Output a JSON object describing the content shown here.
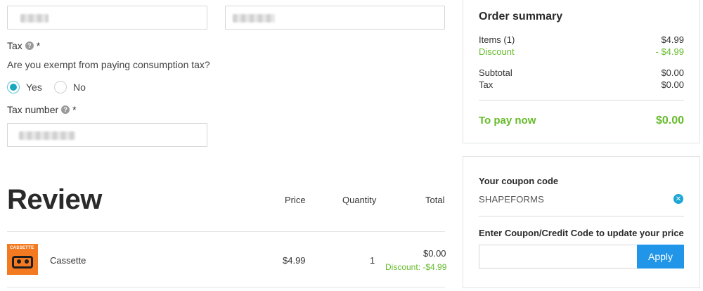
{
  "form": {
    "tax_label": "Tax",
    "tax_required": "*",
    "tax_question": "Are you exempt from paying consumption tax?",
    "options": [
      {
        "label": "Yes",
        "selected": true
      },
      {
        "label": "No",
        "selected": false
      }
    ],
    "tax_number_label": "Tax number",
    "tax_number_required": "*"
  },
  "review": {
    "title": "Review",
    "headers": {
      "price": "Price",
      "quantity": "Quantity",
      "total": "Total"
    },
    "items": [
      {
        "thumb_text": "CASSETTE",
        "name": "Cassette",
        "price": "$4.99",
        "quantity": "1",
        "total": "$0.00",
        "discount": "Discount: -$4.99"
      }
    ]
  },
  "summary": {
    "title": "Order summary",
    "items_label": "Items (1)",
    "items_value": "$4.99",
    "discount_label": "Discount",
    "discount_value": "- $4.99",
    "subtotal_label": "Subtotal",
    "subtotal_value": "$0.00",
    "tax_label": "Tax",
    "tax_value": "$0.00",
    "pay_label": "To pay now",
    "pay_value": "$0.00"
  },
  "coupon": {
    "title": "Your coupon code",
    "code": "SHAPEFORMS",
    "enter_label": "Enter Coupon/Credit Code to update your price",
    "input_placeholder": "",
    "apply_label": "Apply"
  },
  "colors": {
    "accent_green": "#66bb2b",
    "radio_teal": "#1aa6bf",
    "apply_blue": "#2196e8"
  }
}
